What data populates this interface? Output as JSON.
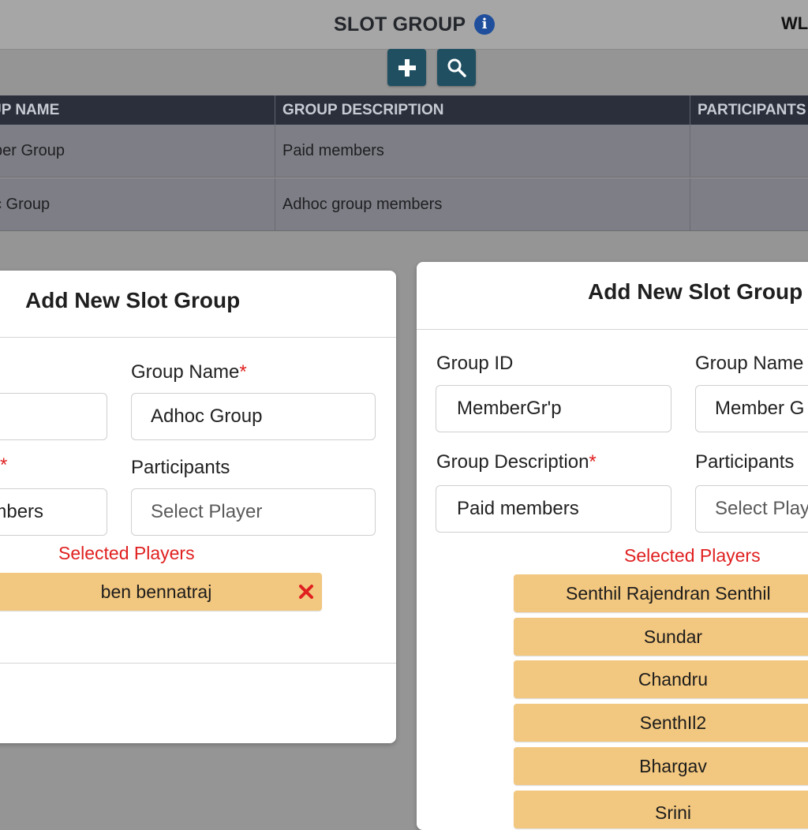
{
  "header": {
    "title": "SLOT GROUP",
    "info_icon": "info-icon",
    "user_text": "WL"
  },
  "toolbar": {
    "add_icon": "plus-icon",
    "search_icon": "search-icon",
    "button_color": "#1f4f61"
  },
  "table": {
    "columns": [
      "UP NAME",
      "GROUP DESCRIPTION",
      "PARTICIPANTS"
    ],
    "rows": [
      {
        "name": "ber Group",
        "description": "Paid members",
        "participants": ""
      },
      {
        "name": "c Group",
        "description": "Adhoc group members",
        "participants": ""
      }
    ]
  },
  "left_panel": {
    "title": "Add New Slot Group",
    "group_name_label": "Group Name",
    "group_name_value": "Adhoc Group",
    "required_mark": "*",
    "description_value": "embers",
    "participants_label": "Participants",
    "participants_placeholder": "Select Player",
    "selected_players_label": "Selected Players",
    "selected_players": [
      "ben bennatraj"
    ],
    "remove_icon": "close-x-icon"
  },
  "right_panel": {
    "title": "Add New Slot Group",
    "group_id_label": "Group ID",
    "group_id_value": "MemberGr'p",
    "group_name_label": "Group Name",
    "group_name_value": "Member G",
    "group_description_label": "Group Description",
    "group_description_value": "Paid members",
    "required_mark": "*",
    "participants_label": "Participants",
    "participants_placeholder": "Select Play",
    "selected_players_label": "Selected Players",
    "selected_players": [
      "Senthil Rajendran Senthil",
      "Sundar",
      "Chandru",
      "SenthIl2",
      "Bhargav",
      "Srini"
    ]
  },
  "colors": {
    "accent_red": "#e02020",
    "pill": "#f2c77f",
    "table_header": "#2a2f3b"
  }
}
